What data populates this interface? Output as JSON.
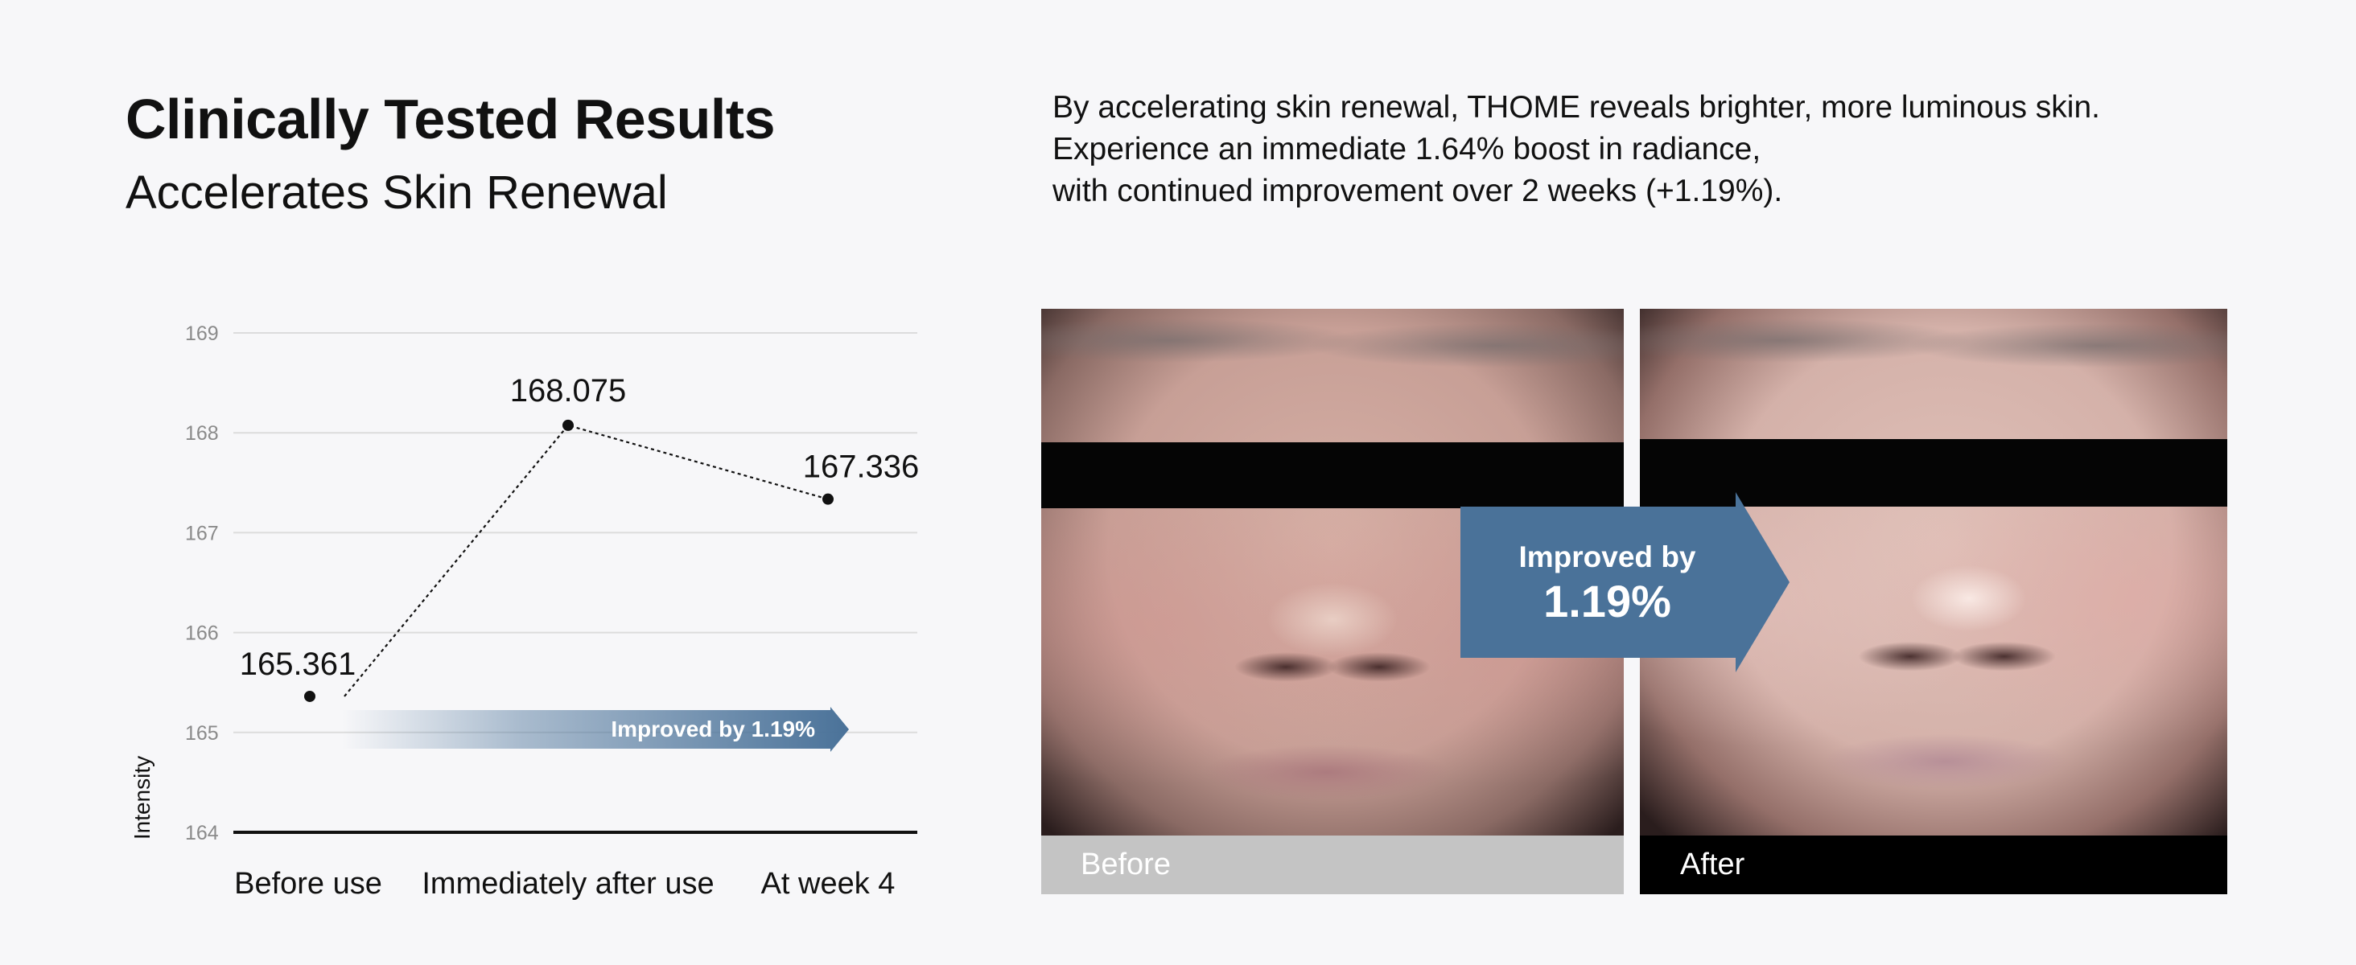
{
  "header": {
    "title": "Clinically Tested Results",
    "subtitle": "Accelerates Skin Renewal"
  },
  "description": {
    "lines": [
      "By accelerating skin renewal, THOME reveals brighter, more luminous skin.",
      "Experience an immediate 1.64% boost in radiance,",
      "with continued improvement over 2 weeks (+1.19%)."
    ]
  },
  "chart_data": {
    "type": "line",
    "categories": [
      "Before use",
      "Immediately after use",
      "At week 4"
    ],
    "values": [
      165.361,
      168.075,
      167.336
    ],
    "data_labels": [
      "165.361",
      "168.075",
      "167.336"
    ],
    "ylabel": "Intensity",
    "ylim": [
      164,
      169
    ],
    "yticks": [
      "164",
      "165",
      "166",
      "167",
      "168",
      "169"
    ],
    "grid": true,
    "line_style": "dotted",
    "annotation": "Improved by 1.19%",
    "colors": {
      "annotation_arrow": "#4a7299",
      "line": "#111111",
      "grid": "#dcdcdc"
    }
  },
  "photos": {
    "before_label": "Before",
    "after_label": "After",
    "improvement_label": "Improved by",
    "improvement_value": "1.19%",
    "accent_color": "#4a7299"
  }
}
